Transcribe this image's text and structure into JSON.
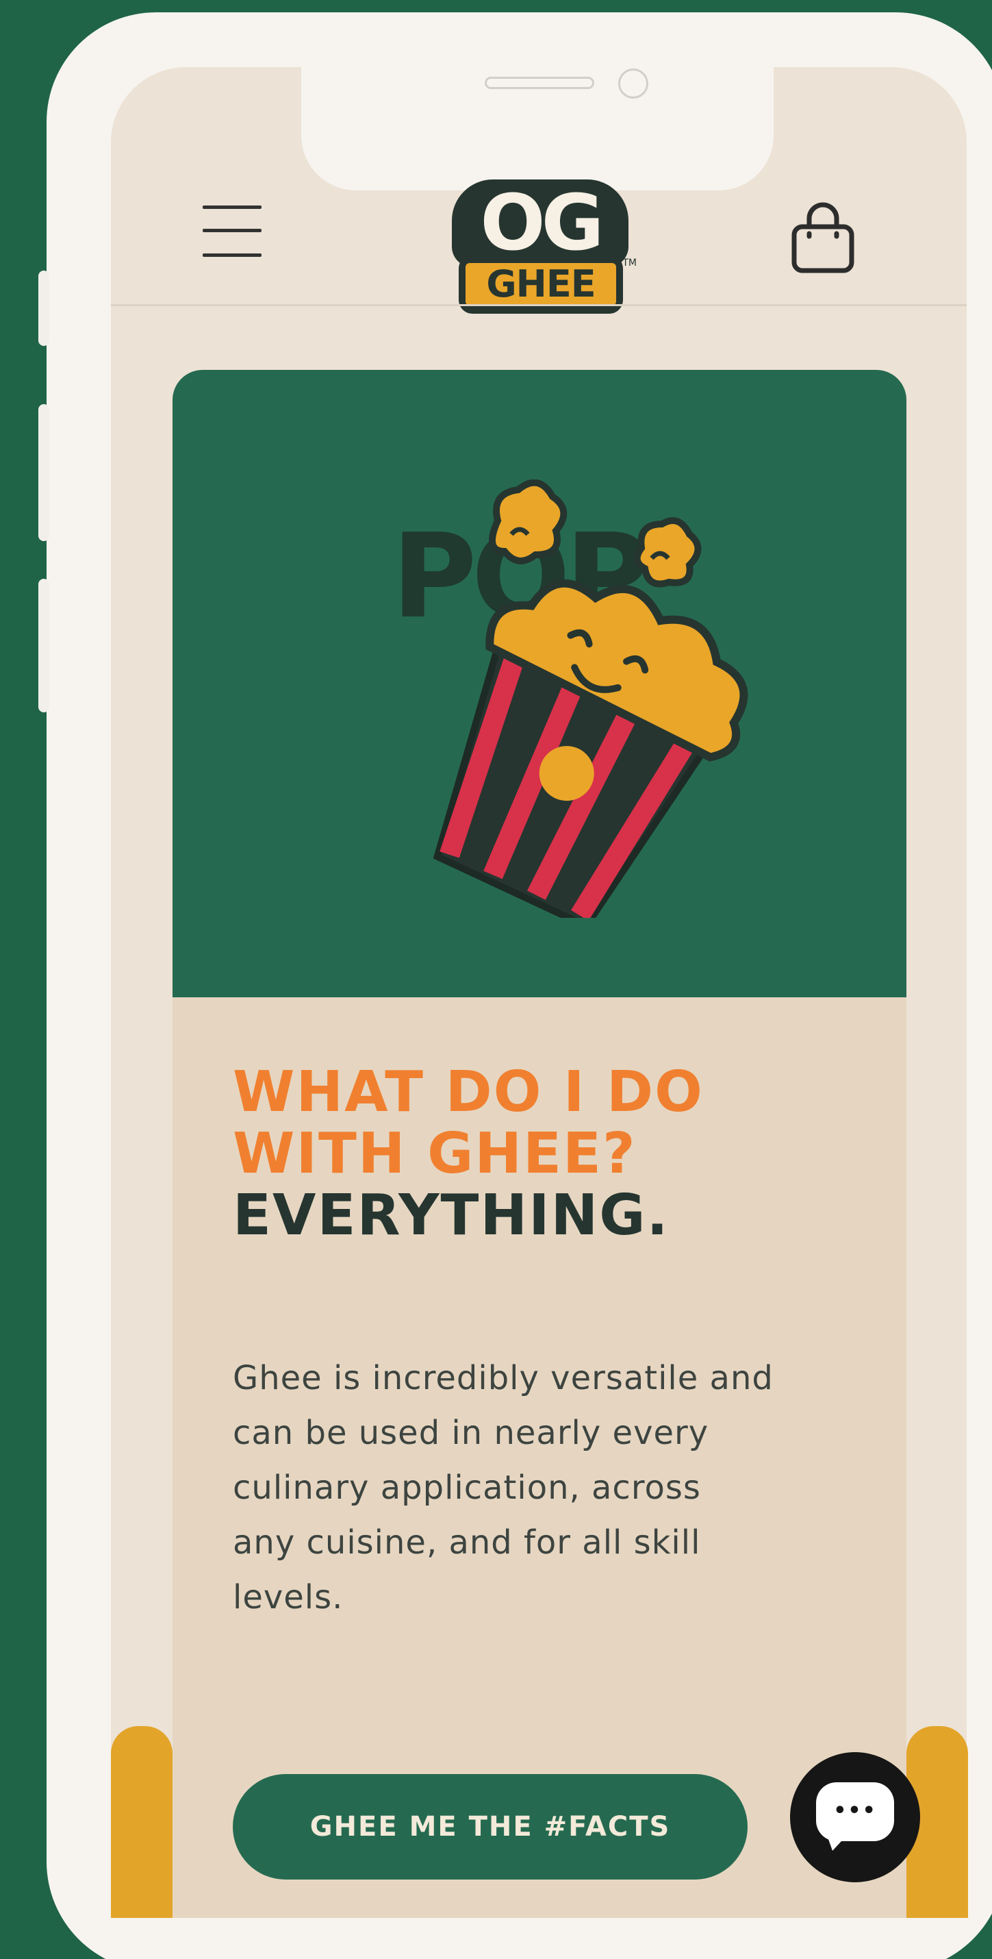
{
  "header": {
    "logo_top": "OG",
    "logo_bottom": "GHEE",
    "logo_tm": "TM"
  },
  "hero": {
    "art_word": "POP"
  },
  "content": {
    "headline_line1": "WHAT DO I DO",
    "headline_line2": "WITH GHEE?",
    "headline_line3": "EVERYTHING.",
    "body_lines": [
      "Ghee is incredibly versatile and",
      "can be used in nearly every",
      "culinary application, across",
      "any cuisine, and for all skill",
      "levels."
    ]
  },
  "cta": {
    "label": "GHEE ME THE #FACTS"
  },
  "chat": {
    "icon": "chat-icon",
    "dots": "•••"
  },
  "colors": {
    "background_green": "#1f6446",
    "hero_green": "#256a50",
    "orange": "#f08030",
    "dark": "#263530",
    "yellow": "#e3a42a",
    "cream": "#e6d6c1",
    "popcorn_red": "#d8314a"
  }
}
